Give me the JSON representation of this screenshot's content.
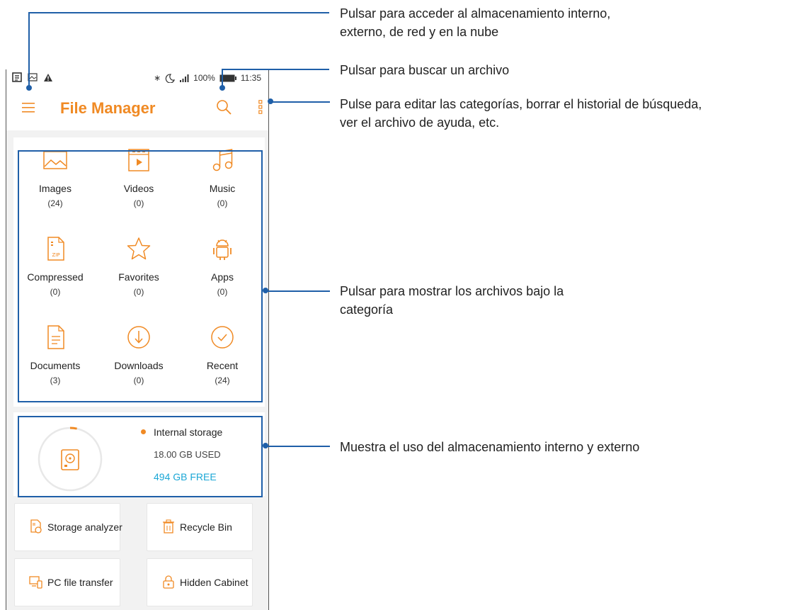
{
  "annotations": {
    "storage_locations": [
      "Pulsar para acceder al almacenamiento interno,",
      "externo, de red y en la nube"
    ],
    "search": [
      "Pulsar para buscar un archivo"
    ],
    "menu": [
      "Pulse para editar las categorías, borrar el historial de búsqueda,",
      "ver el archivo de ayuda, etc."
    ],
    "categories": [
      "Pulsar para mostrar los archivos bajo la",
      "categoría"
    ],
    "storage_usage": [
      "Muestra el uso del almacenamiento interno y externo"
    ]
  },
  "status_bar": {
    "battery": "100%",
    "time": "11:35",
    "icons": [
      "news-icon",
      "image-notification-icon",
      "alert-icon",
      "bluetooth-icon",
      "do-not-disturb-icon",
      "signal-icon",
      "battery-icon"
    ]
  },
  "app_bar": {
    "title": "File Manager",
    "icons": [
      "menu-icon",
      "search-icon",
      "more-options-icon"
    ]
  },
  "categories": [
    {
      "label": "Images",
      "count": "(24)",
      "icon": "image-icon"
    },
    {
      "label": "Videos",
      "count": "(0)",
      "icon": "video-icon"
    },
    {
      "label": "Music",
      "count": "(0)",
      "icon": "music-icon"
    },
    {
      "label": "Compressed",
      "count": "(0)",
      "icon": "zip-icon"
    },
    {
      "label": "Favorites",
      "count": "(0)",
      "icon": "star-icon"
    },
    {
      "label": "Apps",
      "count": "(0)",
      "icon": "android-icon"
    },
    {
      "label": "Documents",
      "count": "(3)",
      "icon": "document-icon"
    },
    {
      "label": "Downloads",
      "count": "(0)",
      "icon": "download-icon"
    },
    {
      "label": "Recent",
      "count": "(24)",
      "icon": "check-circle-icon"
    }
  ],
  "storage": {
    "name": "Internal storage",
    "used": "18.00 GB USED",
    "free": "494 GB FREE",
    "used_fraction": 0.035
  },
  "tools": [
    {
      "label": "Storage analyzer",
      "icon": "storage-analyzer-icon"
    },
    {
      "label": "Recycle Bin",
      "icon": "trash-icon"
    },
    {
      "label": "PC file transfer",
      "icon": "pc-transfer-icon"
    },
    {
      "label": "Hidden Cabinet",
      "icon": "lock-icon"
    }
  ],
  "colors": {
    "accent": "#f08a24",
    "annotation": "#1f5fa8",
    "free_text": "#1ba7d6"
  }
}
